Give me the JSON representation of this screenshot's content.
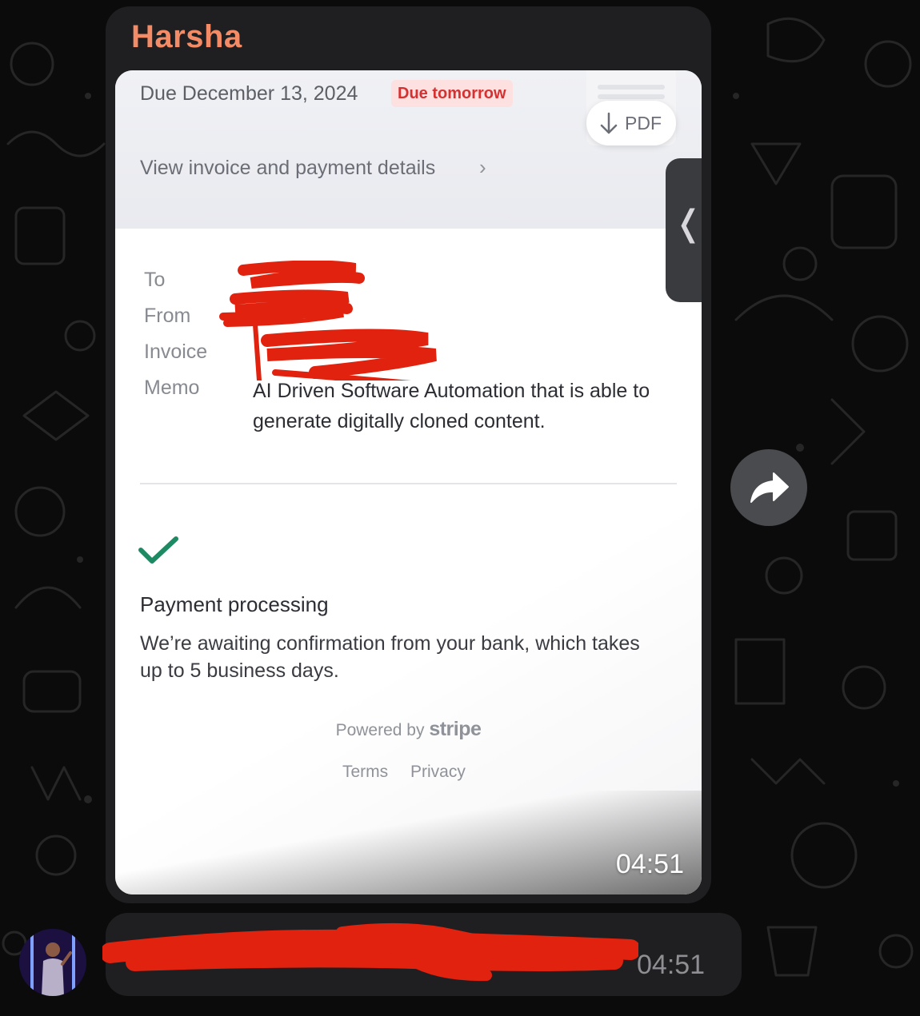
{
  "chat": {
    "sender_name": "Harsha",
    "sender_color": "#f28b66",
    "background_color": "#0b0b0b",
    "bubble_color": "#1f1f21"
  },
  "invoice_screenshot": {
    "due_date": "Due December 13, 2024",
    "due_badge": "Due tomorrow",
    "pdf_label": "PDF",
    "pdf_icon": "arrow-down-icon",
    "view_details_link": "View invoice and payment details",
    "chevron": "›",
    "rows": [
      {
        "label": "To",
        "value": ""
      },
      {
        "label": "From",
        "value": ""
      },
      {
        "label": "Invoice",
        "value": ""
      },
      {
        "label": "Memo",
        "value": "AI Driven Software Automation that is able to generate digitally cloned content."
      }
    ],
    "status_icon": "checkmark-icon",
    "status_title": "Payment processing",
    "status_text": "We’re awaiting confirmation from your bank, which takes up to 5 business days.",
    "powered_by": "Powered by",
    "powered_brand": "stripe",
    "footer_links": [
      "Terms",
      "Privacy"
    ],
    "timestamp": "04:51"
  },
  "side_tab": {
    "icon": "chevron-left-icon",
    "glyph": "❬"
  },
  "forward_button": {
    "icon": "forward-arrow-icon"
  },
  "second_message": {
    "text": "",
    "timestamp": "04:51",
    "avatar_icon": "avatar"
  },
  "accent_colors": {
    "due_badge_bg": "#fde0e0",
    "due_badge_text": "#d63131",
    "check_green": "#1e8a63",
    "redaction_red": "#e0220f"
  }
}
